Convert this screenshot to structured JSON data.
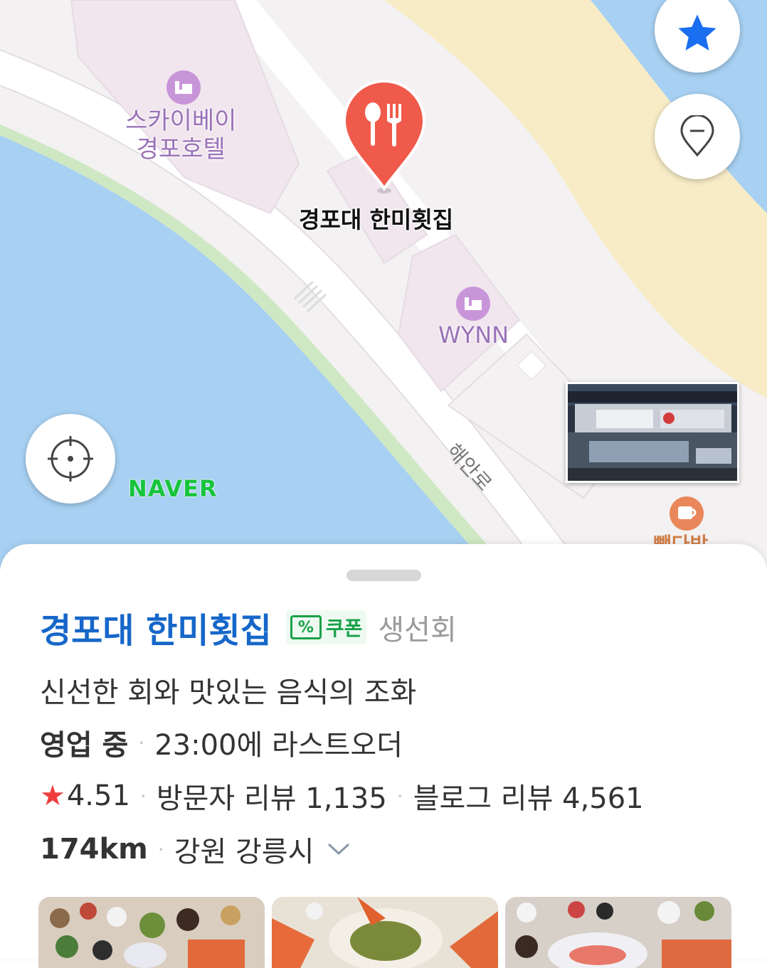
{
  "map": {
    "place_marker_label": "경포대 한미횟집",
    "hotel_name_line1": "스카이베이",
    "hotel_name_line2": "경포호텔",
    "wynn_label": "WYNN",
    "road_label": "해안로",
    "cafe_label": "빽다방",
    "provider_logo": "NAVER",
    "icons": [
      "star-icon",
      "pin-minus-icon",
      "locate-icon",
      "bed-icon",
      "restaurant-icon",
      "coffee-icon"
    ],
    "colors": {
      "water": "#a7d0f2",
      "sand": "#f7ecc6",
      "land": "#f4f1f2",
      "marker": "#f05a4a",
      "naver": "#18c43c"
    }
  },
  "place": {
    "name": "경포대 한미횟집",
    "coupon_label": "쿠폰",
    "coupon_icon": "%",
    "category": "생선회",
    "description": "신선한 회와 맛있는 음식의 조화",
    "status": "영업 중",
    "status_detail": "23:00에 라스트오더",
    "rating_icon": "★",
    "rating": "4.51",
    "visitor_reviews": "방문자 리뷰 1,135",
    "blog_reviews": "블로그 리뷰 4,561",
    "distance": "174km",
    "address": "강원 강릉시"
  },
  "colors": {
    "title": "#1667c9",
    "coupon": "#1aa14a",
    "star": "#f03e3e"
  }
}
